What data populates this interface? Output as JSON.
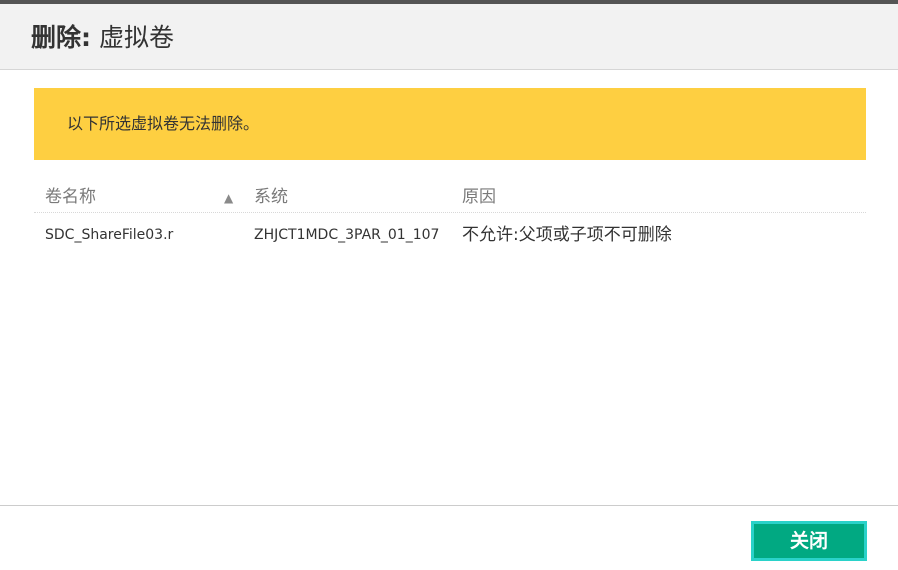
{
  "header": {
    "action": "删除:",
    "title": "虚拟卷"
  },
  "banner": {
    "message": "以下所选虚拟卷无法删除。",
    "color": "#fecf41"
  },
  "table": {
    "columns": [
      "卷名称",
      "系统",
      "原因"
    ],
    "sort_icon": "sort-ascending-icon",
    "rows": [
      {
        "name": "SDC_ShareFile03.r",
        "system": "ZHJCT1MDC_3PAR_01_107",
        "reason": "不允许:父项或子项不可删除"
      }
    ]
  },
  "footer": {
    "close_label": "关闭",
    "close_color": "#01a982"
  }
}
